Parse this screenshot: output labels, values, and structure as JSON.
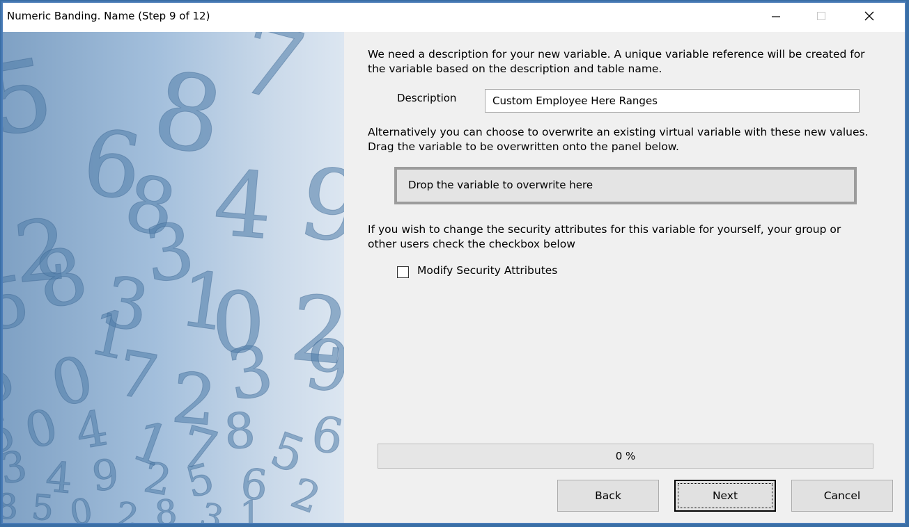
{
  "window": {
    "title": "Numeric Banding.  Name (Step 9 of 12)"
  },
  "intro_text": "We need a description for your new variable.  A unique variable reference will be created for the variable based on the description and table name.",
  "description": {
    "label": "Description",
    "value": "Custom Employee Here Ranges"
  },
  "overwrite_text": "Alternatively you can choose to overwrite an existing virtual variable with these new values. Drag the variable to be overwritten onto the panel below.",
  "drop_panel": {
    "label": "Drop the variable to overwrite here"
  },
  "security_text": "If you wish to change the security attributes for this variable for  yourself, your group or other users check the checkbox below",
  "security_checkbox": {
    "label": "Modify Security Attributes",
    "checked": false
  },
  "progress": {
    "label": "0 %",
    "value": 0
  },
  "buttons": {
    "back": "Back",
    "next": "Next",
    "cancel": "Cancel"
  },
  "side_image": {
    "icon": "numbers-background-image",
    "digits": [
      "5",
      "6",
      "8",
      "7",
      "2",
      "8",
      "3",
      "4",
      "9",
      "5",
      "1",
      "0",
      "2",
      "8",
      "3",
      "1",
      "5",
      "0",
      "7",
      "2",
      "3",
      "9",
      "6",
      "0",
      "4",
      "1",
      "7",
      "8",
      "5",
      "6",
      "3",
      "4",
      "9",
      "2",
      "5",
      "6",
      "2",
      "8",
      "5",
      "0",
      "2",
      "8",
      "3",
      "1"
    ]
  },
  "colors": {
    "side_gradient_dark": "#7fa1c4",
    "side_gradient_light": "#dce6f1",
    "digit_fill": "#4f7ba8",
    "window_border": "#4a7cb8"
  }
}
